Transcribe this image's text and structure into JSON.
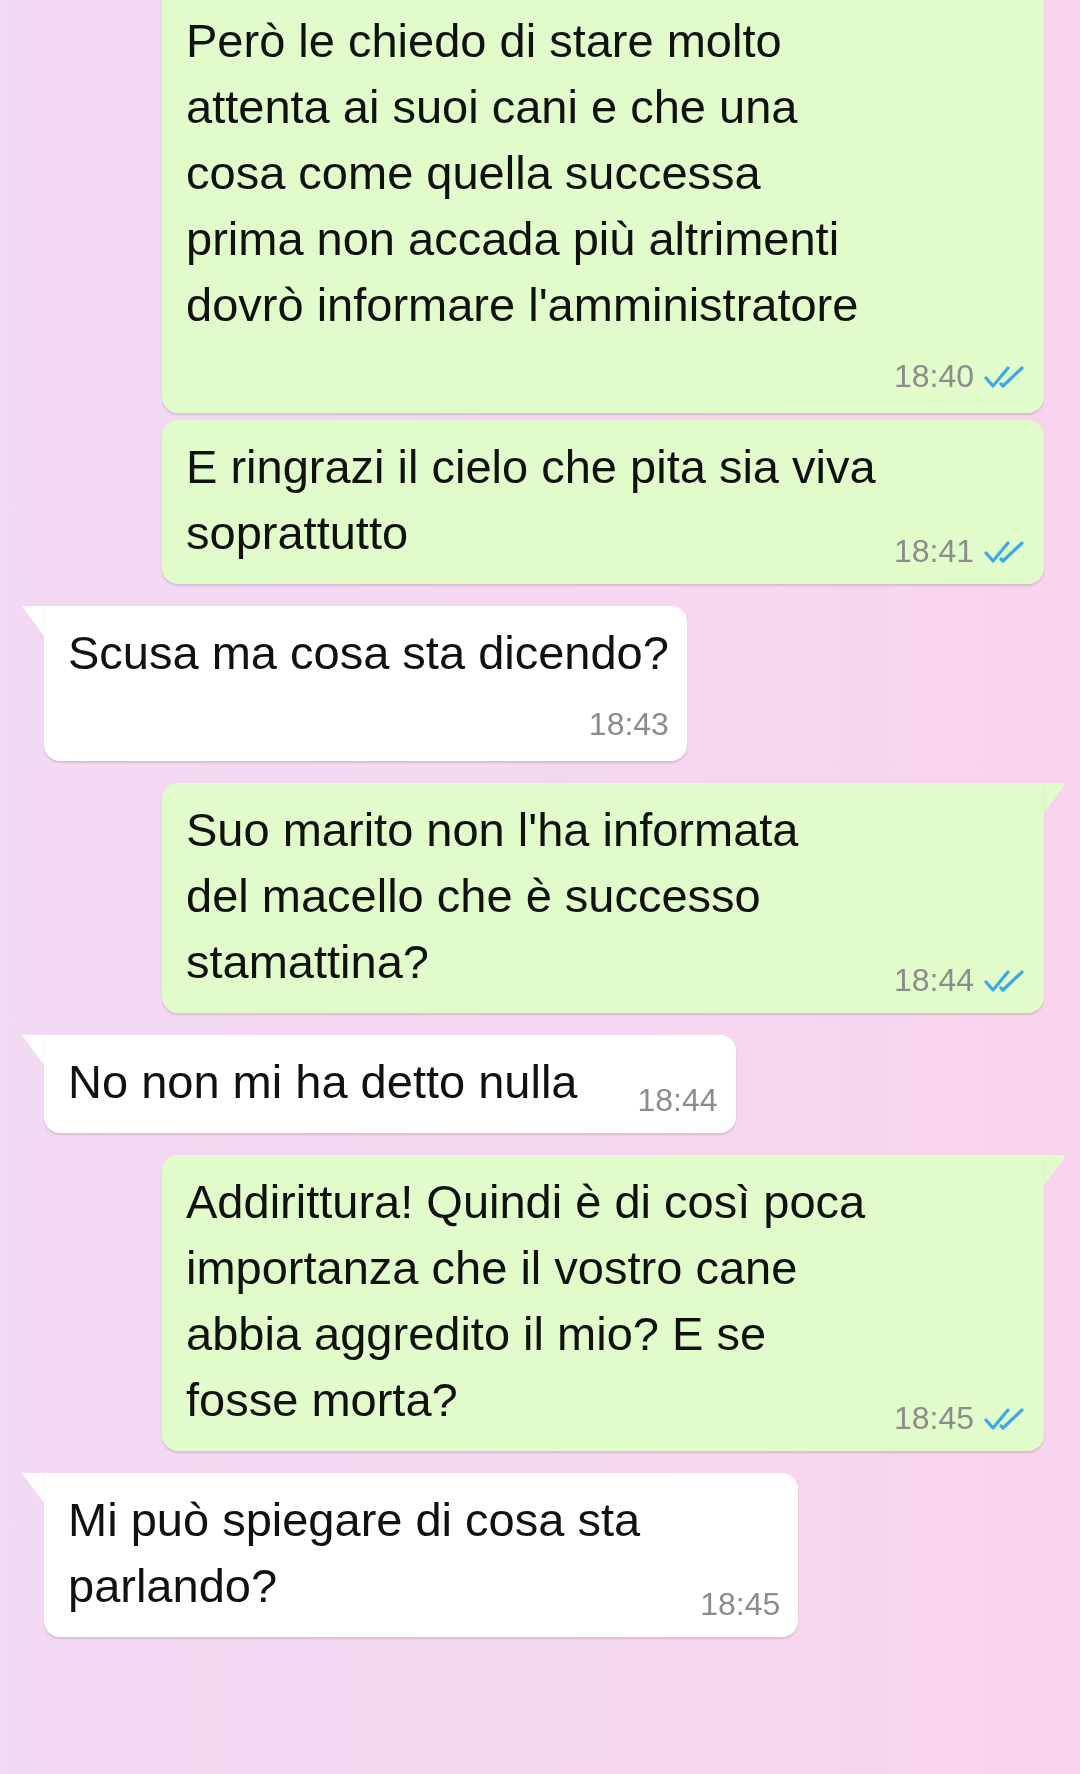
{
  "messages": [
    {
      "kind": "out",
      "lines": [
        "Però le chiedo di stare molto",
        "attenta ai suoi cani e che una",
        "cosa come quella successa",
        "prima non accada più altrimenti",
        "dovrò informare l'amministratore"
      ],
      "time": "18:40",
      "read": true,
      "time_below": true
    },
    {
      "kind": "out",
      "lines": [
        "E ringrazi il cielo che pita sia viva",
        "soprattutto"
      ],
      "time": "18:41",
      "read": true,
      "time_below": false
    },
    {
      "kind": "in",
      "lines": [
        "Scusa ma cosa sta dicendo?"
      ],
      "time": "18:43",
      "time_below": true
    },
    {
      "kind": "out",
      "lines": [
        "Suo marito non l'ha informata",
        "del macello che è successo",
        "stamattina?"
      ],
      "time": "18:44",
      "read": true,
      "time_below": false
    },
    {
      "kind": "in",
      "lines": [
        "No non mi ha detto nulla"
      ],
      "time": "18:44",
      "time_below": false
    },
    {
      "kind": "out",
      "lines": [
        "Addirittura! Quindi è di così poca",
        "importanza che il vostro cane",
        "abbia aggredito il mio? E se",
        "fosse morta?"
      ],
      "time": "18:45",
      "read": true,
      "time_below": false
    },
    {
      "kind": "in",
      "lines": [
        "Mi può spiegare di cosa sta",
        "parlando?"
      ],
      "time": "18:45",
      "time_below": false
    }
  ]
}
